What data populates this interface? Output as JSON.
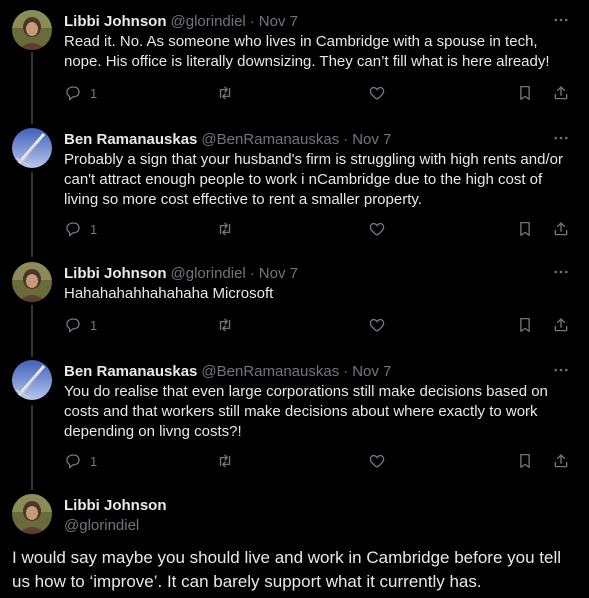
{
  "tweets": [
    {
      "name": "Libbi Johnson",
      "handle": "@glorindiel",
      "separator": "·",
      "time": "Nov 7",
      "text": "Read it. No. As someone who lives in Cambridge with a spouse in tech, nope. His office is literally downsizing. They can’t fill what is here already!",
      "reply_count": "1",
      "avatar": "libbi-avatar"
    },
    {
      "name": "Ben Ramanauskas",
      "handle": "@BenRamanauskas",
      "separator": "·",
      "time": "Nov 7",
      "text": "Probably a sign that your husband's firm is struggling with high rents and/or can't attract enough people to work i nCambridge due to the high cost of living so more cost effective to rent a smaller property.",
      "reply_count": "1",
      "avatar": "ben-avatar"
    },
    {
      "name": "Libbi Johnson",
      "handle": "@glorindiel",
      "separator": "·",
      "time": "Nov 7",
      "text": "Hahahahahhahahaha Microsoft",
      "reply_count": "1",
      "avatar": "libbi-avatar"
    },
    {
      "name": "Ben Ramanauskas",
      "handle": "@BenRamanauskas",
      "separator": "·",
      "time": "Nov 7",
      "text": "You do realise that even large corporations still make decisions based on costs and that workers still make decisions about where exactly to work depending on livng costs?!",
      "reply_count": "1",
      "avatar": "ben-avatar"
    }
  ],
  "main_tweet": {
    "name": "Libbi Johnson",
    "handle": "@glorindiel",
    "text": "I would say maybe you should live and work in Cambridge before you tell us how to ‘improve’. It can barely support what it currently has."
  },
  "icons": {
    "reply": "reply-icon",
    "retweet": "retweet-icon",
    "like": "heart-icon",
    "bookmark": "bookmark-icon",
    "share": "share-icon",
    "more": "more-icon"
  },
  "colors": {
    "background": "#000000",
    "text": "#e7e9ea",
    "muted": "#71767b",
    "thread_line": "#333639"
  }
}
